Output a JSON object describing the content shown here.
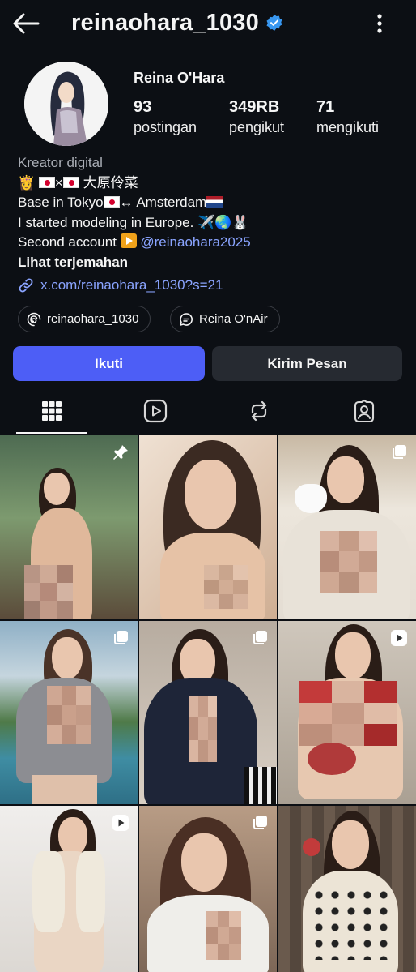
{
  "header": {
    "username": "reinaohara_1030",
    "verified": true,
    "icons": [
      "back-arrow-icon",
      "verified-badge-icon",
      "more-vertical-icon"
    ]
  },
  "profile": {
    "full_name": "Reina O'Hara",
    "stats": [
      {
        "value": "93",
        "label": "postingan"
      },
      {
        "value": "349RB",
        "label": "pengikut"
      },
      {
        "value": "71",
        "label": "mengikuti"
      }
    ],
    "category": "Kreator digital",
    "bio_line1_tail": "大原伶菜",
    "bio_line2_a": "Base in Tokyo",
    "bio_line2_b": "↔ Amsterdam",
    "bio_line3": "I started modeling in Europe. ✈️🌏🐰",
    "bio_line4_a": "Second account ",
    "bio_line4_handle": "@reinaohara2025",
    "see_translation": "Lihat terjemahan",
    "external_link": "x.com/reinaohara_1030?s=21"
  },
  "chips": [
    {
      "label": "reinaohara_1030",
      "icon": "threads-icon"
    },
    {
      "label": "Reina O'nAir",
      "icon": "chat-bubble-icon"
    }
  ],
  "actions": {
    "follow": "Ikuti",
    "message": "Kirim Pesan"
  },
  "tabs": [
    {
      "name": "grid",
      "icon": "grid-icon",
      "active": true
    },
    {
      "name": "reels",
      "icon": "reels-play-icon",
      "active": false
    },
    {
      "name": "reposts",
      "icon": "repost-icon",
      "active": false
    },
    {
      "name": "tagged",
      "icon": "tagged-person-icon",
      "active": false
    }
  ],
  "posts": [
    {
      "badge": "pin-icon",
      "bg": "#6f8f72"
    },
    {
      "badge": "none",
      "bg": "#d9c2ae"
    },
    {
      "badge": "carousel-icon",
      "bg": "#c9b8a3"
    },
    {
      "badge": "carousel-icon",
      "bg": "#8fa6b8"
    },
    {
      "badge": "carousel-icon",
      "bg": "#c7b9a8"
    },
    {
      "badge": "reel-play-icon",
      "bg": "#b8b1a6"
    },
    {
      "badge": "reel-play-icon",
      "bg": "#e6e1dc"
    },
    {
      "badge": "carousel-icon",
      "bg": "#a89482"
    },
    {
      "badge": "none",
      "bg": "#5f5247"
    }
  ],
  "colors": {
    "background": "#0c0f14",
    "accent": "#4d5ef6",
    "link": "#8aa4ff",
    "secondary_button": "#262a31",
    "verified": "#3897f0"
  }
}
